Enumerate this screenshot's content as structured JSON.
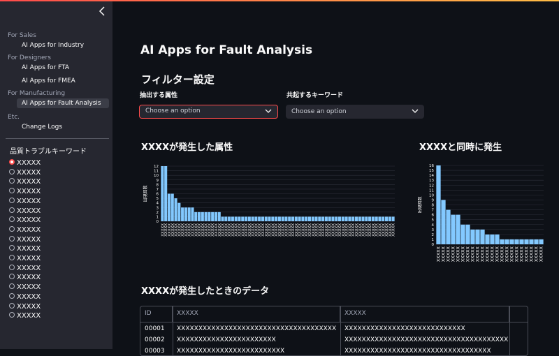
{
  "sidebar": {
    "collapse_icon": "chevron-left-icon",
    "groups": [
      {
        "title": "For Sales",
        "items": [
          {
            "label": "AI Apps for Industry",
            "active": false
          }
        ]
      },
      {
        "title": "For Designers",
        "items": [
          {
            "label": "AI Apps for FTA",
            "active": false
          },
          {
            "label": "AI Apps for FMEA",
            "active": false
          }
        ]
      },
      {
        "title": "For Manufacturing",
        "items": [
          {
            "label": "AI Apps for Fault Analysis",
            "active": true
          }
        ]
      },
      {
        "title": "Etc.",
        "items": [
          {
            "label": "Change Logs",
            "active": false
          }
        ]
      }
    ],
    "radio_title": "品質トラブルキーワード",
    "radio_options": [
      "XXXXX",
      "XXXXX",
      "XXXXX",
      "XXXXX",
      "XXXXX",
      "XXXXX",
      "XXXXX",
      "XXXXX",
      "XXXXX",
      "XXXXX",
      "XXXXX",
      "XXXXX",
      "XXXXX",
      "XXXXX",
      "XXXXX",
      "XXXXX",
      "XXXXX"
    ],
    "radio_selected": 0
  },
  "main": {
    "title": "AI Apps for Fault Analysis",
    "filter_heading": "フィルター設定",
    "filter1": {
      "label": "抽出する属性",
      "placeholder": "Choose an option"
    },
    "filter2": {
      "label": "共起するキーワード",
      "placeholder": "Choose an option"
    },
    "chart1_heading": "XXXXが発生した属性",
    "chart2_heading": "XXXXと同時に発生",
    "table_heading": "XXXXが発生したときのデータ",
    "table": {
      "headers": [
        "ID",
        "XXXXX",
        "XXXXX"
      ],
      "rows": [
        [
          "00001",
          "XXXXXXXXXXXXXXXXXXXXXXXXXXXXXXXXXXXXX",
          "XXXXXXXXXXXXXXXXXXXXXXXXXXXX"
        ],
        [
          "00002",
          "XXXXXXXXXXXXXXXXXXXXXXX",
          "XXXXXXXXXXXXXXXXXXXXXXXXXXXXXXXXXXXXXX"
        ],
        [
          "00003",
          "XXXXXXXXXXXXXXXXXXXXXXXXX",
          "XXXXXXXXXXXXXXXXXXXXXXXXXXXXXXXXXX"
        ]
      ]
    }
  },
  "chart_data": [
    {
      "type": "bar",
      "ylabel": "出現回数",
      "yticks": [
        0,
        1,
        2,
        3,
        4,
        5,
        6,
        7,
        8,
        9,
        10,
        11,
        12
      ],
      "ylim": [
        0,
        12
      ],
      "grid": true,
      "bar_color": "#83c9ff",
      "category_label": "XXXXX",
      "values": [
        12,
        12,
        6,
        6,
        5,
        4,
        3,
        3,
        3,
        3,
        2,
        2,
        2,
        2,
        2,
        2,
        2,
        2,
        1,
        1,
        1,
        1,
        1,
        1,
        1,
        1,
        1,
        1,
        1,
        1,
        1,
        1,
        1,
        1,
        1,
        1,
        1,
        1,
        1,
        1,
        1,
        1,
        1,
        1,
        1,
        1,
        1,
        1,
        1,
        1,
        1,
        1,
        1,
        1,
        1,
        1,
        1,
        1,
        1,
        1,
        1,
        1,
        1,
        1,
        1,
        1,
        1,
        1,
        1,
        1
      ]
    },
    {
      "type": "bar",
      "ylabel": "出現回数",
      "yticks": [
        0,
        1,
        2,
        3,
        4,
        5,
        6,
        7,
        8,
        9,
        10,
        11,
        12,
        13,
        14,
        15,
        16
      ],
      "ylim": [
        0,
        16
      ],
      "grid": true,
      "bar_color": "#83c9ff",
      "category_label": "XXXXX",
      "values": [
        16,
        9,
        7,
        6,
        6,
        4,
        4,
        3,
        3,
        3,
        2,
        2,
        2,
        1,
        1,
        1,
        1,
        1,
        1,
        1,
        1,
        1
      ]
    }
  ]
}
